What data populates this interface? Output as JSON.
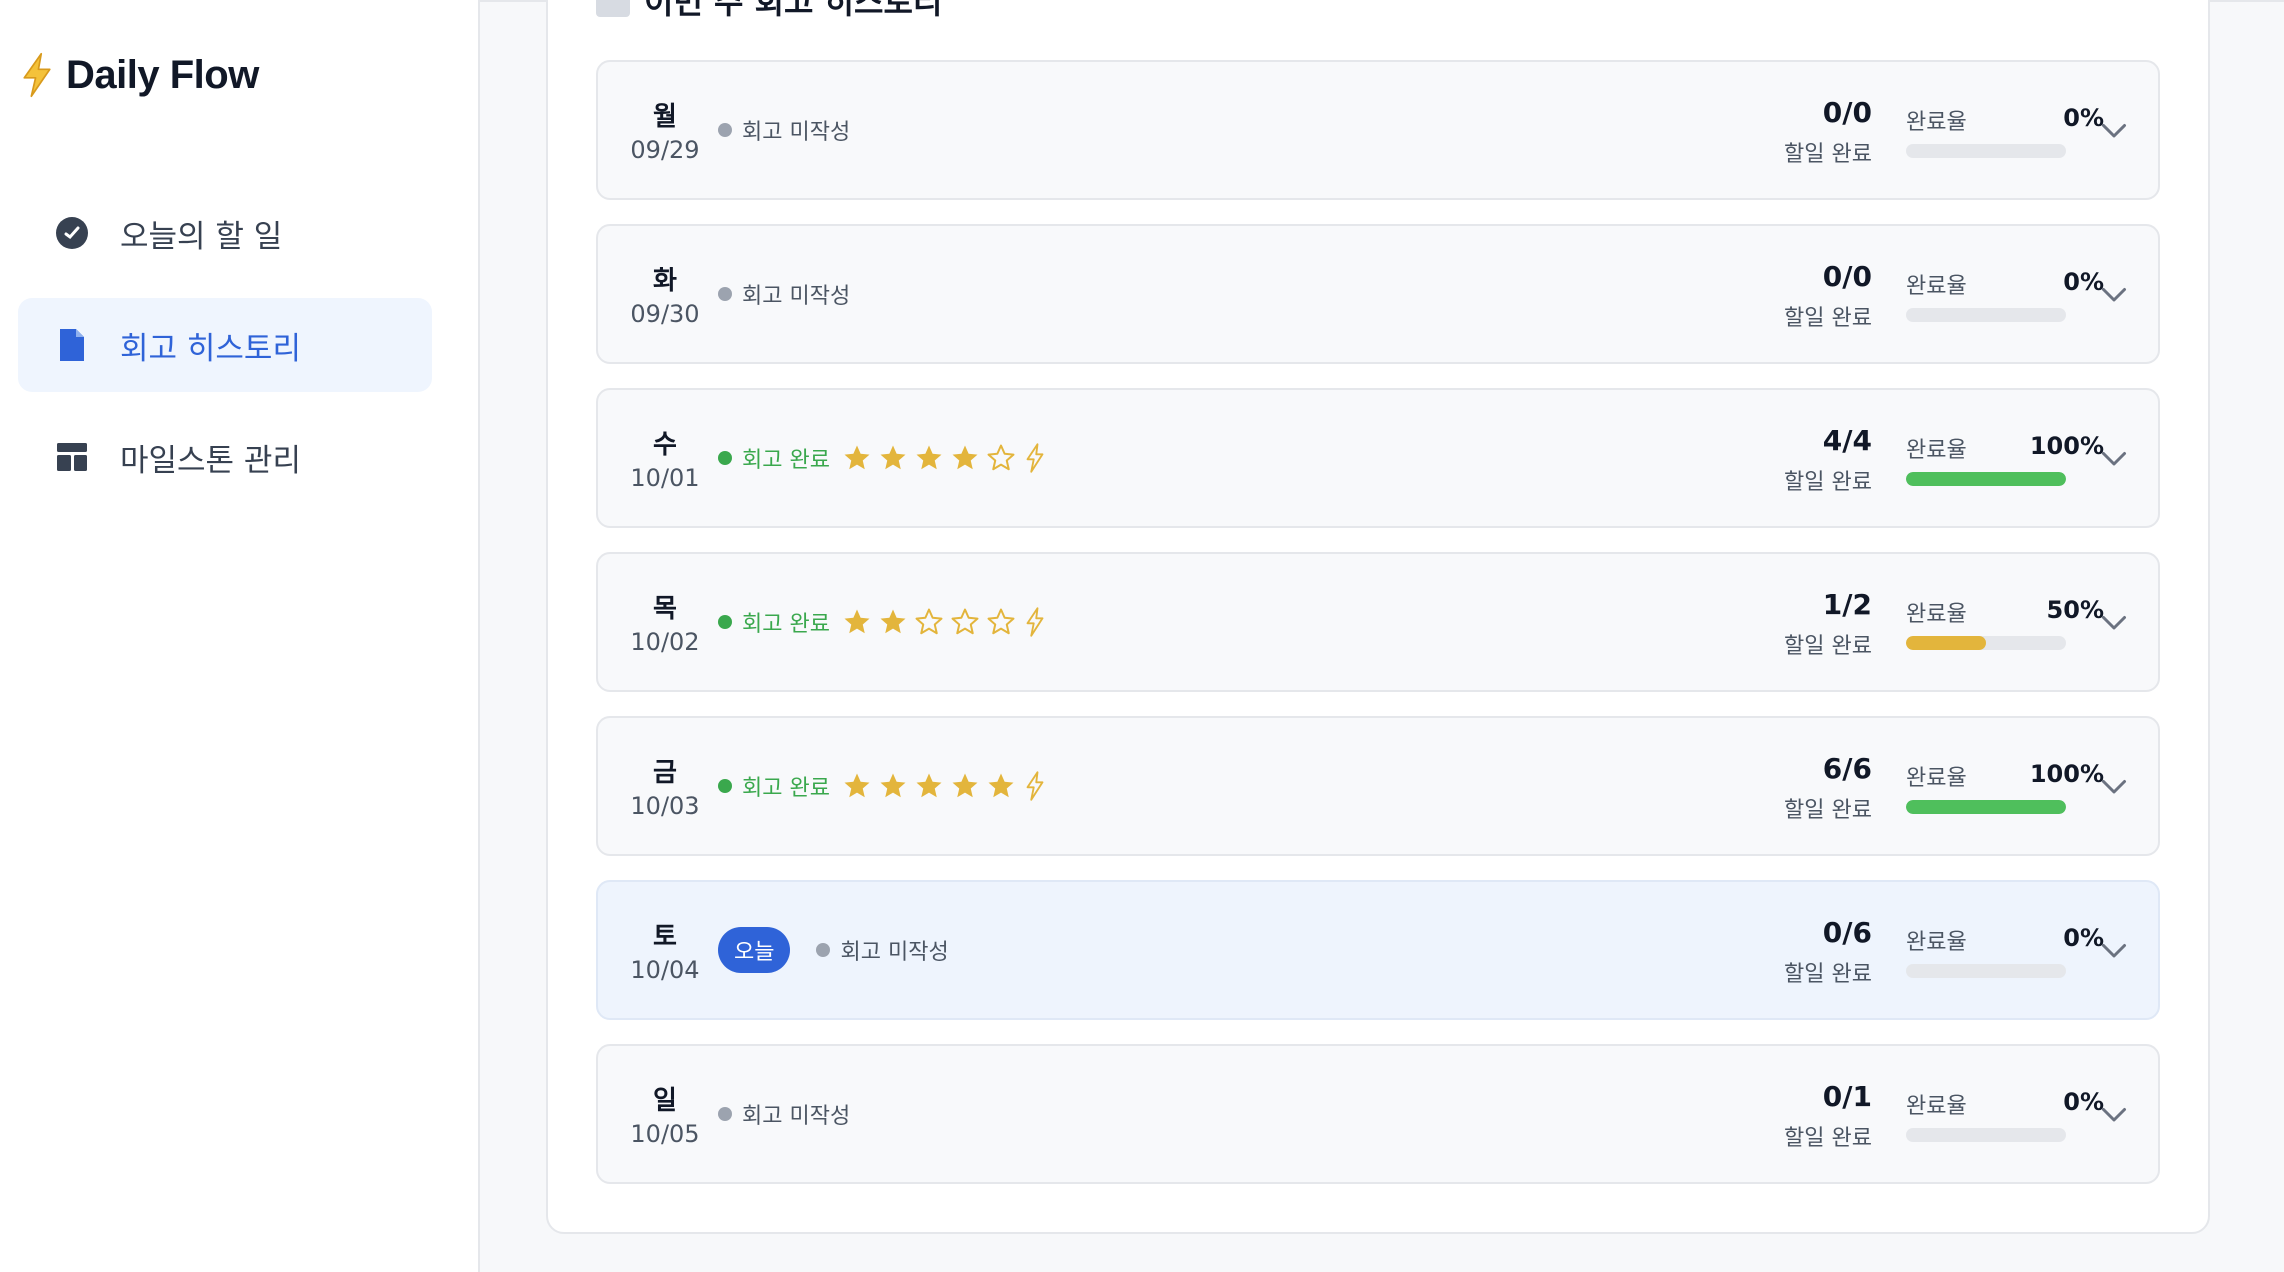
{
  "app": {
    "title": "Daily Flow",
    "accent": "#2f63d8"
  },
  "sidebar": {
    "items": [
      {
        "label": "오늘의 할 일",
        "icon": "clock-check-icon",
        "active": false
      },
      {
        "label": "회고 히스토리",
        "icon": "document-icon",
        "active": true
      },
      {
        "label": "마일스톤 관리",
        "icon": "layout-icon",
        "active": false
      }
    ]
  },
  "main": {
    "section_title": "이번 주 회고 히스토리",
    "days": [
      {
        "weekday": "월",
        "date": "09/29",
        "today": false,
        "today_label": "",
        "status": "회고 미작성",
        "done": false,
        "rating": null,
        "count": "0/0",
        "count_label": "할일 완료",
        "rate_label": "완료율",
        "rate": "0%",
        "progress": 0,
        "color": "#e5e7eb"
      },
      {
        "weekday": "화",
        "date": "09/30",
        "today": false,
        "today_label": "",
        "status": "회고 미작성",
        "done": false,
        "rating": null,
        "count": "0/0",
        "count_label": "할일 완료",
        "rate_label": "완료율",
        "rate": "0%",
        "progress": 0,
        "color": "#e5e7eb"
      },
      {
        "weekday": "수",
        "date": "10/01",
        "today": false,
        "today_label": "",
        "status": "회고 완료",
        "done": true,
        "rating": 4,
        "count": "4/4",
        "count_label": "할일 완료",
        "rate_label": "완료율",
        "rate": "100%",
        "progress": 1.0,
        "color": "#4fbf5c"
      },
      {
        "weekday": "목",
        "date": "10/02",
        "today": false,
        "today_label": "",
        "status": "회고 완료",
        "done": true,
        "rating": 2,
        "count": "1/2",
        "count_label": "할일 완료",
        "rate_label": "완료율",
        "rate": "50%",
        "progress": 0.5,
        "color": "#e3b53c"
      },
      {
        "weekday": "금",
        "date": "10/03",
        "today": false,
        "today_label": "",
        "status": "회고 완료",
        "done": true,
        "rating": 5,
        "count": "6/6",
        "count_label": "할일 완료",
        "rate_label": "완료율",
        "rate": "100%",
        "progress": 1.0,
        "color": "#4fbf5c"
      },
      {
        "weekday": "토",
        "date": "10/04",
        "today": true,
        "today_label": "오늘",
        "status": "회고 미작성",
        "done": false,
        "rating": null,
        "count": "0/6",
        "count_label": "할일 완료",
        "rate_label": "완료율",
        "rate": "0%",
        "progress": 0,
        "color": "#e5e7eb"
      },
      {
        "weekday": "일",
        "date": "10/05",
        "today": false,
        "today_label": "",
        "status": "회고 미작성",
        "done": false,
        "rating": null,
        "count": "0/1",
        "count_label": "할일 완료",
        "rate_label": "완료율",
        "rate": "0%",
        "progress": 0,
        "color": "#e5e7eb"
      }
    ],
    "colors": {
      "done": "#3aa84d",
      "pending": "#9ca3af",
      "star": "#e3b53c"
    }
  }
}
